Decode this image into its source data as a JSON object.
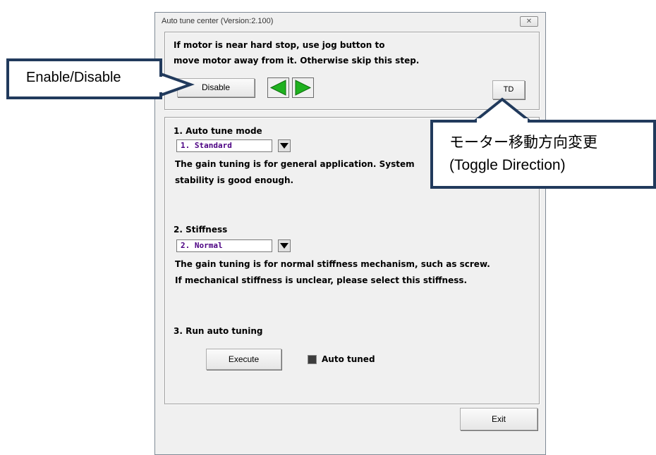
{
  "window": {
    "title": "Auto tune center (Version:2.100)",
    "close_glyph": "✕"
  },
  "jog": {
    "instruction_line1": "If motor is near hard stop, use jog button to",
    "instruction_line2": "move motor away from it. Otherwise skip this step.",
    "disable_label": "Disable",
    "left_arrow_icon": "green-left-triangle",
    "right_arrow_icon": "green-right-triangle",
    "td_label": "TD",
    "arrow_color": "#1fb11f"
  },
  "mode": {
    "heading": "1. Auto tune mode",
    "selected": "1. Standard",
    "desc_line1": "The gain tuning is for general application. System",
    "desc_line2": "stability is good enough."
  },
  "stiffness": {
    "heading": "2. Stiffness",
    "selected": "2. Normal",
    "desc_line1": "The gain tuning is for normal stiffness mechanism, such as screw.",
    "desc_line2": "If mechanical stiffness is unclear, please select this stiffness."
  },
  "run": {
    "heading": "3. Run auto tuning",
    "execute_label": "Execute",
    "auto_tuned_label": "Auto tuned"
  },
  "exit_label": "Exit",
  "callouts": {
    "enable_disable": "Enable/Disable",
    "toggle_line1": "モーター移動方向変更",
    "toggle_line2": "(Toggle Direction)",
    "border_color": "#213a5c"
  }
}
